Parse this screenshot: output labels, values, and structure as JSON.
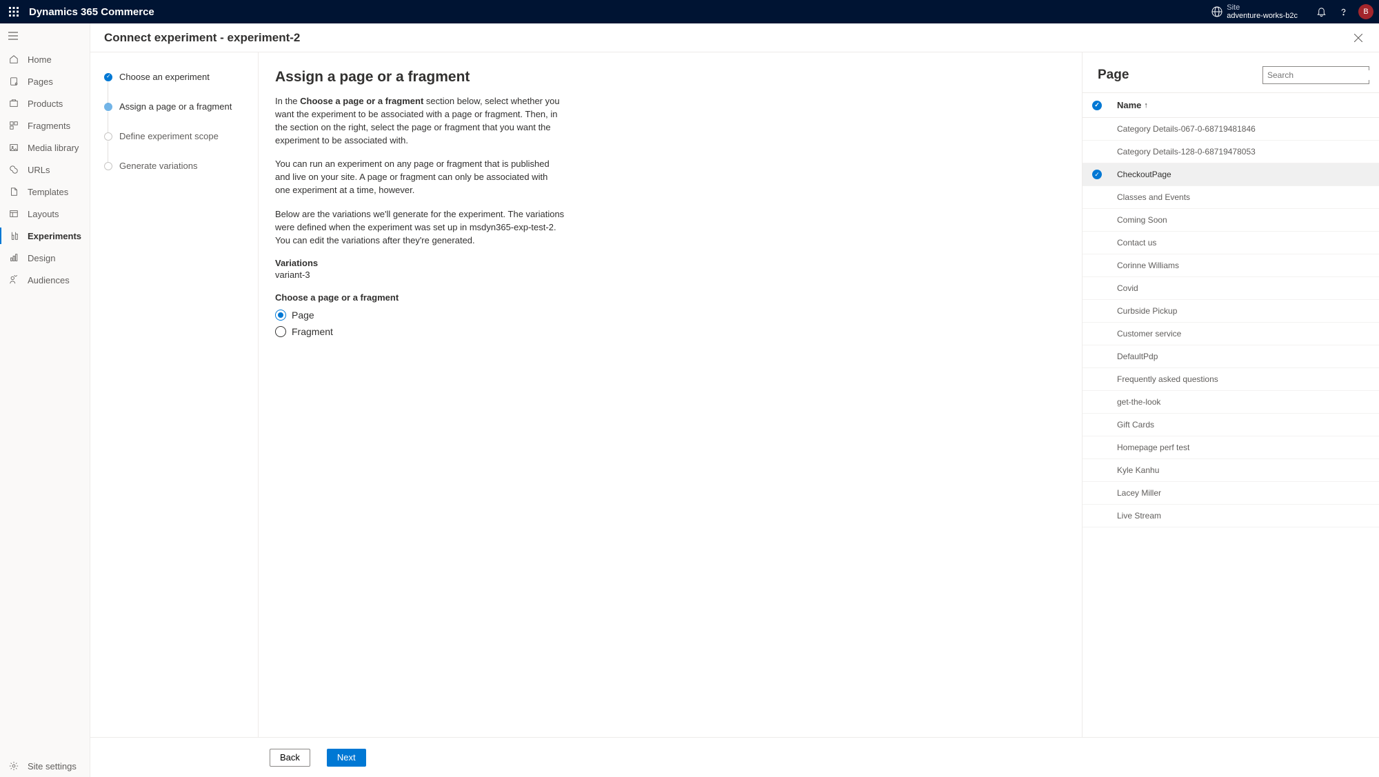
{
  "top": {
    "app": "Dynamics 365 Commerce",
    "site_label": "Site",
    "site_name": "adventure-works-b2c",
    "avatar_initial": "B"
  },
  "sidebar": {
    "items": [
      {
        "label": "Home"
      },
      {
        "label": "Pages"
      },
      {
        "label": "Products"
      },
      {
        "label": "Fragments"
      },
      {
        "label": "Media library"
      },
      {
        "label": "URLs"
      },
      {
        "label": "Templates"
      },
      {
        "label": "Layouts"
      },
      {
        "label": "Experiments"
      },
      {
        "label": "Design"
      },
      {
        "label": "Audiences"
      }
    ],
    "settings": "Site settings"
  },
  "panel": {
    "title": "Connect experiment - experiment-2",
    "steps": [
      {
        "label": "Choose an experiment"
      },
      {
        "label": "Assign a page or a fragment"
      },
      {
        "label": "Define experiment scope"
      },
      {
        "label": "Generate variations"
      }
    ],
    "main": {
      "heading": "Assign a page or a fragment",
      "p1_prefix": "In the ",
      "p1_bold": "Choose a page or a fragment",
      "p1_suffix": " section below, select whether you want the experiment to be associated with a page or fragment. Then, in the section on the right, select the page or fragment that you want the experiment to be associated with.",
      "p2": "You can run an experiment on any page or fragment that is published and live on your site. A page or fragment can only be associated with one experiment at a time, however.",
      "p3": "Below are the variations we'll generate for the experiment. The variations were defined when the experiment was set up in msdyn365-exp-test-2. You can edit the variations after they're generated.",
      "variations_label": "Variations",
      "variations_value": "variant-3",
      "choose_label": "Choose a page or a fragment",
      "opt_page": "Page",
      "opt_fragment": "Fragment"
    },
    "right": {
      "heading": "Page",
      "search_placeholder": "Search",
      "name_col": "Name",
      "rows": [
        "Category Details-067-0-68719481846",
        "Category Details-128-0-68719478053",
        "CheckoutPage",
        "Classes and Events",
        "Coming Soon",
        "Contact us",
        "Corinne Williams",
        "Covid",
        "Curbside Pickup",
        "Customer service",
        "DefaultPdp",
        "Frequently asked questions",
        "get-the-look",
        "Gift Cards",
        "Homepage perf test",
        "Kyle Kanhu",
        "Lacey Miller",
        "Live Stream"
      ],
      "selected_index": 2
    },
    "footer": {
      "back": "Back",
      "next": "Next"
    }
  }
}
